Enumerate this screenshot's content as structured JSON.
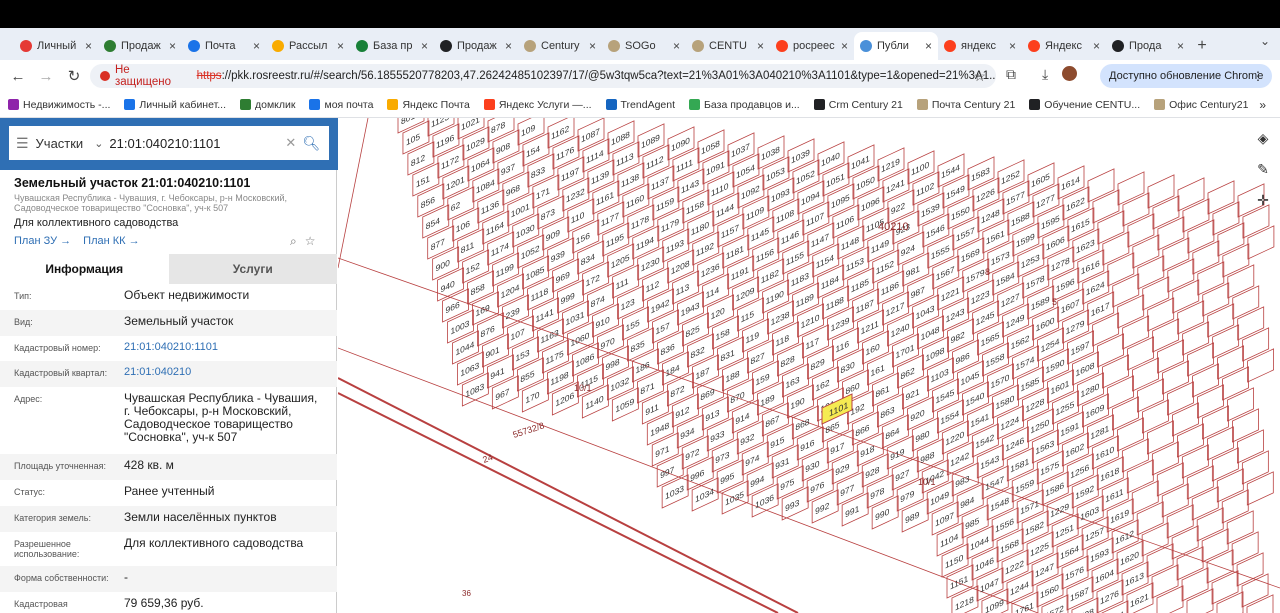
{
  "browser": {
    "tabs": [
      {
        "title": "Личный",
        "color": "#e53935",
        "active": false
      },
      {
        "title": "Продаж",
        "color": "#2e7d32",
        "active": false
      },
      {
        "title": "Почта",
        "color": "#1a73e8",
        "active": false
      },
      {
        "title": "Рассыл",
        "color": "#f9ab00",
        "active": false
      },
      {
        "title": "База пр",
        "color": "#188038",
        "active": false
      },
      {
        "title": "Продаж",
        "color": "#202124",
        "active": false
      },
      {
        "title": "Century",
        "color": "#b7a27b",
        "active": false
      },
      {
        "title": "SOGo",
        "color": "#b7a27b",
        "active": false
      },
      {
        "title": "CENTU",
        "color": "#b7a27b",
        "active": false
      },
      {
        "title": "росреес",
        "color": "#fc3f1d",
        "active": false
      },
      {
        "title": "Публи",
        "color": "#4a90d9",
        "active": true
      },
      {
        "title": "яндекс",
        "color": "#fc3f1d",
        "active": false
      },
      {
        "title": "Яндекс",
        "color": "#fc3f1d",
        "active": false
      },
      {
        "title": "Прода",
        "color": "#202124",
        "active": false
      }
    ],
    "security": "Не защищено",
    "url_scheme": "https",
    "url_rest": "://pkk.rosreestr.ru/#/search/56.1855520778203,47.26242485102397/17/@5w3tqw5ca?text=21%3A01%3A040210%3A1101&type=1&opened=21%3A1...",
    "update_label": "Доступно обновление Chrome",
    "bookmarks": [
      {
        "label": "Недвижимость -...",
        "color": "#8e24aa"
      },
      {
        "label": "Личный кабинет...",
        "color": "#1a73e8"
      },
      {
        "label": "домклик",
        "color": "#2e7d32"
      },
      {
        "label": "моя почта",
        "color": "#1a73e8"
      },
      {
        "label": "Яндекс Почта",
        "color": "#f9ab00"
      },
      {
        "label": "Яндекс Услуги —...",
        "color": "#fc3f1d"
      },
      {
        "label": "TrendAgent",
        "color": "#1565c0"
      },
      {
        "label": "База продавцов и...",
        "color": "#34a853"
      },
      {
        "label": "Crm Century 21",
        "color": "#202124"
      },
      {
        "label": "Почта Century 21",
        "color": "#b7a27b"
      },
      {
        "label": "Обучение CENTU...",
        "color": "#202124"
      },
      {
        "label": "Офис Century21",
        "color": "#b7a27b"
      }
    ]
  },
  "search": {
    "type": "Участки",
    "query": "21:01:040210:1101"
  },
  "parcel": {
    "title": "Земельный участок 21:01:040210:1101",
    "address_short": "Чувашская Республика - Чувашия, г. Чебоксары, р-н Московский, Садоводческое товарищество \"Сосновка\", уч-к 507",
    "purpose": "Для коллективного садоводства",
    "link_zu": "План ЗУ",
    "link_kk": "План КК",
    "tab_info": "Информация",
    "tab_services": "Услуги",
    "fields": [
      {
        "label": "Тип:",
        "value": "Объект недвижимости",
        "link": false
      },
      {
        "label": "Вид:",
        "value": "Земельный участок",
        "link": false
      },
      {
        "label": "Кадастровый номер:",
        "value": "21:01:040210:1101",
        "link": true
      },
      {
        "label": "Кадастровый квартал:",
        "value": "21:01:040210",
        "link": true
      },
      {
        "label": "Адрес:",
        "value": "Чувашская Республика - Чувашия, г. Чебоксары, р-н Московский, Садоводческое товарищество \"Сосновка\", уч-к 507",
        "link": false
      },
      {
        "label": "Площадь уточненная:",
        "value": "428 кв. м",
        "link": false
      },
      {
        "label": "Статус:",
        "value": "Ранее учтенный",
        "link": false
      },
      {
        "label": "Категория земель:",
        "value": "Земли населённых пунктов",
        "link": false
      },
      {
        "label": "Разрешенное использование:",
        "value": "Для коллективного садоводства",
        "link": false
      },
      {
        "label": "Форма собственности:",
        "value": "-",
        "link": false
      },
      {
        "label": "Кадастровая",
        "value": "79 659,36 руб.",
        "link": false
      }
    ]
  },
  "map": {
    "quarter_label": "40210",
    "highlight": "1101",
    "road_label": "55732/8",
    "labels": [
      "10/1",
      "10/1",
      "24",
      "36",
      "5",
      "8"
    ],
    "plot_numbers": [
      "801",
      "105",
      "812",
      "151",
      "856",
      "854",
      "877",
      "900",
      "940",
      "966",
      "1003",
      "1044",
      "1063",
      "1083",
      "1123",
      "1196",
      "1172",
      "1201",
      "62",
      "106",
      "811",
      "152",
      "858",
      "169",
      "876",
      "901",
      "941",
      "967",
      "1021",
      "1029",
      "1064",
      "1084",
      "1136",
      "1164",
      "1174",
      "1199",
      "1204",
      "239",
      "107",
      "153",
      "855",
      "170",
      "878",
      "908",
      "937",
      "968",
      "1001",
      "1030",
      "1052",
      "1085",
      "1118",
      "1141",
      "1163",
      "1175",
      "1198",
      "1206",
      "109",
      "154",
      "833",
      "171",
      "873",
      "909",
      "939",
      "969",
      "999",
      "1031",
      "1060",
      "1086",
      "1115",
      "1140",
      "1162",
      "1176",
      "1197",
      "1232",
      "110",
      "156",
      "834",
      "172",
      "874",
      "910",
      "970",
      "998",
      "1032",
      "1059",
      "1087",
      "1114",
      "1139",
      "1161",
      "1177",
      "1195",
      "1205",
      "111",
      "123",
      "155",
      "835",
      "186",
      "871",
      "911",
      "1948",
      "971",
      "997",
      "1033",
      "1088",
      "1113",
      "1138",
      "1160",
      "1178",
      "1194",
      "1230",
      "112",
      "1942",
      "157",
      "836",
      "184",
      "872",
      "912",
      "934",
      "972",
      "996",
      "1034",
      "1089",
      "1112",
      "1137",
      "1159",
      "1179",
      "1193",
      "1208",
      "113",
      "1943",
      "825",
      "832",
      "187",
      "869",
      "913",
      "933",
      "973",
      "995",
      "1035",
      "1090",
      "1111",
      "1143",
      "1158",
      "1180",
      "1192",
      "1236",
      "114",
      "120",
      "158",
      "831",
      "188",
      "870",
      "914",
      "932",
      "974",
      "994",
      "1036",
      "1058",
      "1091",
      "1110",
      "1144",
      "1157",
      "1181",
      "1191",
      "1209",
      "115",
      "119",
      "827",
      "159",
      "189",
      "867",
      "915",
      "931",
      "975",
      "993",
      "1037",
      "1054",
      "1092",
      "1109",
      "1145",
      "1156",
      "1182",
      "1190",
      "1238",
      "118",
      "828",
      "163",
      "190",
      "868",
      "916",
      "930",
      "976",
      "992",
      "1038",
      "1053",
      "1093",
      "1108",
      "1146",
      "1155",
      "1183",
      "1189",
      "1210",
      "117",
      "829",
      "162",
      "191",
      "865",
      "917",
      "929",
      "977",
      "991",
      "1039",
      "1052",
      "1094",
      "1107",
      "1147",
      "1154",
      "1184",
      "1188",
      "1239",
      "116",
      "830",
      "860",
      "192",
      "866",
      "918",
      "928",
      "978",
      "990",
      "1040",
      "1051",
      "1095",
      "1106",
      "1148",
      "1153",
      "1185",
      "1187",
      "1211",
      "160",
      "161",
      "861",
      "863",
      "864",
      "919",
      "927",
      "979",
      "989",
      "1041",
      "1050",
      "1096",
      "1105",
      "1149",
      "1152",
      "1186",
      "1217",
      "1240",
      "1701",
      "862",
      "921",
      "920",
      "980",
      "988",
      "1042",
      "1049",
      "1097",
      "1104",
      "1150",
      "1151",
      "1218",
      "1219",
      "1241",
      "922",
      "923",
      "924",
      "981",
      "987",
      "1043",
      "1048",
      "1098",
      "1103",
      "1545",
      "1554",
      "1220",
      "1242",
      "983",
      "984",
      "985",
      "1044",
      "1046",
      "1047",
      "1099",
      "1100",
      "1102",
      "1539",
      "1546",
      "1555",
      "1567",
      "1221",
      "1243",
      "982",
      "986",
      "1045",
      "1540",
      "1541",
      "1542",
      "1543",
      "1547",
      "1548",
      "1556",
      "1568",
      "1222",
      "1244",
      "1761",
      "1544",
      "1549",
      "1550",
      "1557",
      "1569",
      "1579",
      "1223",
      "1245",
      "1565",
      "1558",
      "1570",
      "1580",
      "1224",
      "1246",
      "1581",
      "1559",
      "1571",
      "1582",
      "1225",
      "1247",
      "1560",
      "1572",
      "1583",
      "1226",
      "1248",
      "1561",
      "1573",
      "1584",
      "1227",
      "1249",
      "1562",
      "1574",
      "1585",
      "1228",
      "1250",
      "1563",
      "1575",
      "1586",
      "1229",
      "1251",
      "1564",
      "1576",
      "1587",
      "1598",
      "1252",
      "1577",
      "1588",
      "1599",
      "1253",
      "1578",
      "1589",
      "1600",
      "1254",
      "1590",
      "1601",
      "1255",
      "1591",
      "1602",
      "1256",
      "1592",
      "1603",
      "1257",
      "1593",
      "1604",
      "1276",
      "1594",
      "1605",
      "1277",
      "1595",
      "1606",
      "1278",
      "1596",
      "1607",
      "1279",
      "1597",
      "1608",
      "1280",
      "1609",
      "1281",
      "1610",
      "1618",
      "1611",
      "1619",
      "1612",
      "1620",
      "1613",
      "1621",
      "1614",
      "1622",
      "1615",
      "1623",
      "1616",
      "1624",
      "1617"
    ]
  }
}
